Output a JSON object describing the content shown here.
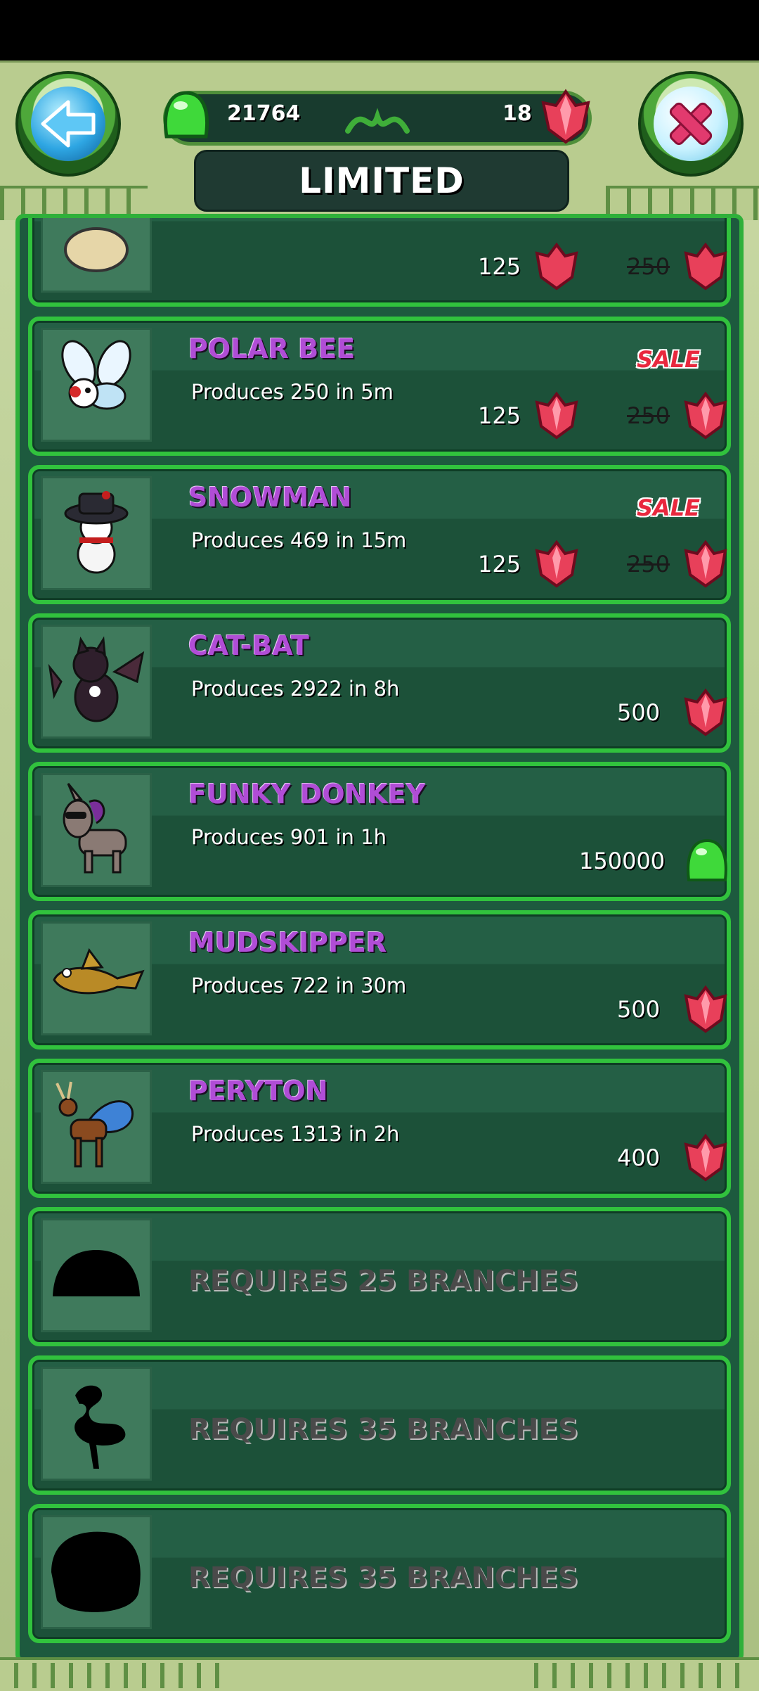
{
  "header": {
    "title": "LIMITED",
    "green_currency": "21764",
    "gem_currency": "18",
    "back_button": "back",
    "close_button": "close"
  },
  "list": {
    "partial_item": {
      "sale_price": "125",
      "old_price": "250"
    },
    "items": [
      {
        "name": "POLAR BEE",
        "produces": "Produces 250 in 5m",
        "sale": "SALE",
        "price": "125",
        "old_price": "250",
        "currency": "gem"
      },
      {
        "name": "SNOWMAN",
        "produces": "Produces 469 in 15m",
        "sale": "SALE",
        "price": "125",
        "old_price": "250",
        "currency": "gem"
      },
      {
        "name": "CAT-BAT",
        "produces": "Produces 2922 in 8h",
        "price": "500",
        "currency": "gem"
      },
      {
        "name": "FUNKY DONKEY",
        "produces": "Produces 901 in 1h",
        "price": "150000",
        "currency": "green"
      },
      {
        "name": "MUDSKIPPER",
        "produces": "Produces 722 in 30m",
        "price": "500",
        "currency": "gem"
      },
      {
        "name": "PERYTON",
        "produces": "Produces 1313 in 2h",
        "price": "400",
        "currency": "gem"
      }
    ],
    "locked": [
      {
        "text": "REQUIRES 25 BRANCHES"
      },
      {
        "text": "REQUIRES 35 BRANCHES"
      },
      {
        "text": "REQUIRES 35 BRANCHES"
      }
    ]
  },
  "colors": {
    "name_purple": "#b04dd6",
    "row_border": "#31c23d",
    "row_bg": "#1c5139",
    "sale_red": "#e8283e"
  }
}
